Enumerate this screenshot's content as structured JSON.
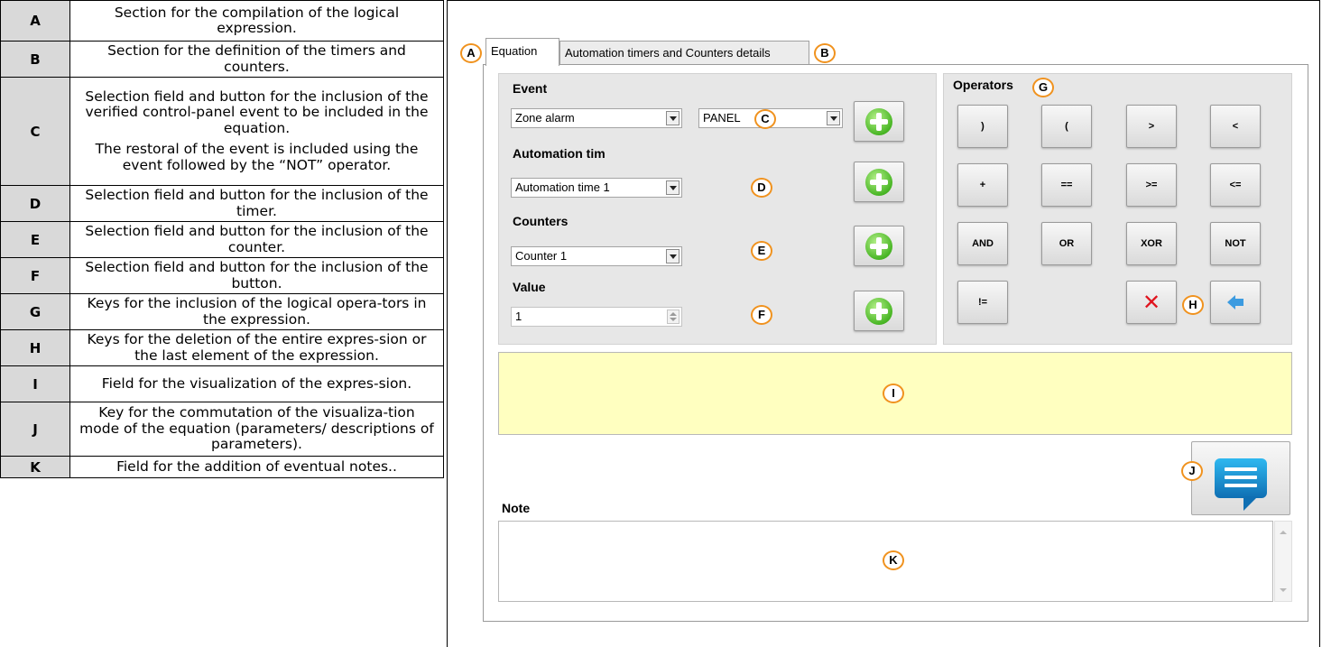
{
  "legend": [
    {
      "key": "A",
      "desc": [
        "Section for the compilation of the logical expression."
      ]
    },
    {
      "key": "B",
      "desc": [
        "Section for the definition of the timers and counters."
      ]
    },
    {
      "key": "C",
      "desc": [
        "Selection field and button for the inclusion of the verified control-panel event to be included in the equation.",
        "The restoral of the event is included using the event followed by the “NOT” operator."
      ]
    },
    {
      "key": "D",
      "desc": [
        "Selection field and button for the inclusion of the timer."
      ]
    },
    {
      "key": "E",
      "desc": [
        "Selection field and button for the inclusion of the counter."
      ]
    },
    {
      "key": "F",
      "desc": [
        "Selection field and button for the inclusion of the button."
      ]
    },
    {
      "key": "G",
      "desc": [
        "Keys for the inclusion of the logical opera-tors in the expression."
      ]
    },
    {
      "key": "H",
      "desc": [
        "Keys for the deletion of the entire expres-sion or the last element of the expression."
      ]
    },
    {
      "key": "I",
      "desc": [
        "Field for the visualization of the expres-sion."
      ]
    },
    {
      "key": "J",
      "desc": [
        "Key for the commutation of the visualiza-tion mode of the equation (parameters/ descriptions of parameters)."
      ]
    },
    {
      "key": "K",
      "desc": [
        "Field for the addition of eventual notes.."
      ]
    }
  ],
  "tabs": {
    "equation": "Equation",
    "timers": "Automation timers and Counters details"
  },
  "left": {
    "event_label": "Event",
    "event_value": "Zone alarm",
    "source_value": "PANEL",
    "timer_label": "Automation tim",
    "timer_value": "Automation time 1",
    "counters_label": "Counters",
    "counter_value": "Counter 1",
    "value_label": "Value",
    "value_value": "1"
  },
  "operators": {
    "label": "Operators",
    "keys": [
      ")",
      "(",
      ">",
      "<",
      "+",
      "==",
      ">=",
      "<=",
      "AND",
      "OR",
      "XOR",
      "NOT",
      "!="
    ]
  },
  "note_label": "Note",
  "markers": {
    "A": "A",
    "B": "B",
    "C": "C",
    "D": "D",
    "E": "E",
    "F": "F",
    "G": "G",
    "H": "H",
    "I": "I",
    "J": "J",
    "K": "K"
  },
  "colors": {
    "marker": "#f0921e",
    "expression_bg": "#ffffc0",
    "group_bg": "#e7e7e7",
    "legend_key_bg": "#d9d9d9"
  }
}
